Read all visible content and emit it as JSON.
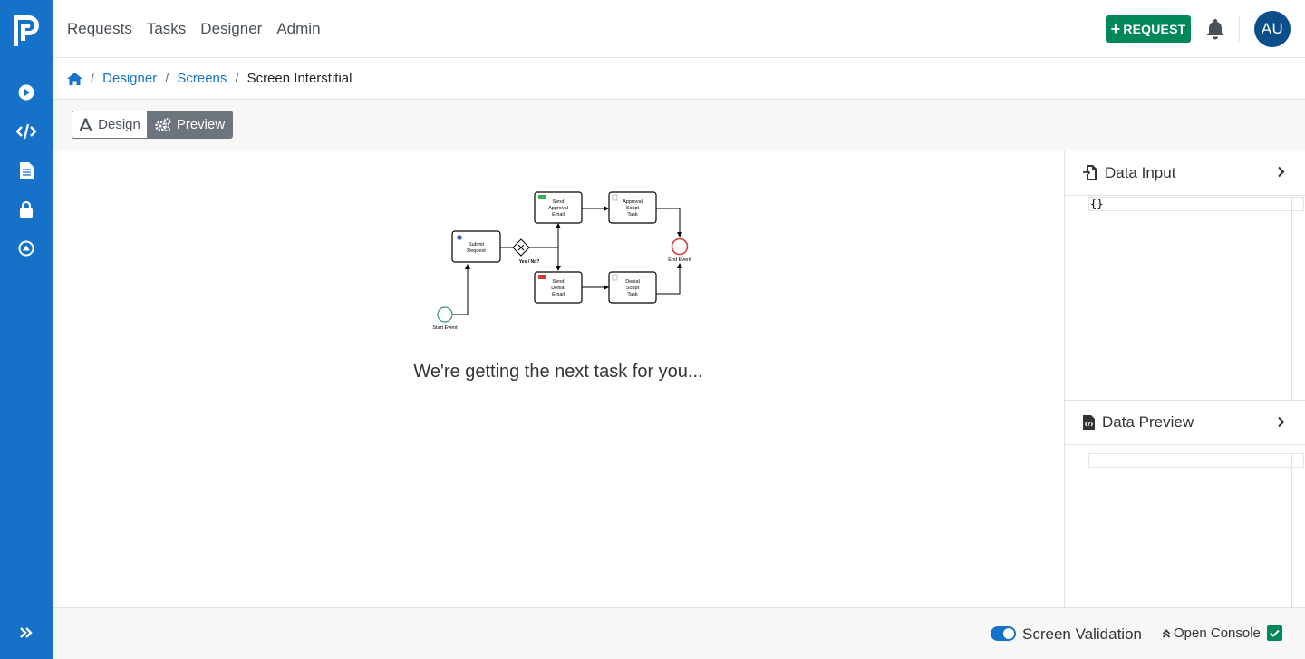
{
  "nav": {
    "links": [
      "Requests",
      "Tasks",
      "Designer",
      "Admin"
    ],
    "request_button": "REQUEST",
    "avatar_initials": "AU"
  },
  "sidebar": {
    "items": [
      "play-circle-icon",
      "code-icon",
      "file-icon",
      "lock-icon",
      "upload-circle-icon"
    ]
  },
  "breadcrumb": {
    "items": [
      "Designer",
      "Screens"
    ],
    "current": "Screen Interstitial"
  },
  "toolbar": {
    "design_label": "Design",
    "preview_label": "Preview"
  },
  "diagram": {
    "nodes": {
      "submit": [
        "Submit",
        "Request"
      ],
      "approval_email": [
        "Send",
        "Approval",
        "Email"
      ],
      "approval_script": [
        "Approval",
        "Script",
        "Task"
      ],
      "denial_email": [
        "Send",
        "Denial",
        "Email"
      ],
      "denial_script": [
        "Denial",
        "Script",
        "Task"
      ],
      "start_event": "Start Event",
      "end_event": "End Event",
      "gateway_label": "Yes / No?"
    }
  },
  "main": {
    "loading_message": "We're getting the next task for you..."
  },
  "right_panel": {
    "data_input_title": "Data Input",
    "data_input_value": "{}",
    "data_preview_title": "Data Preview"
  },
  "footer": {
    "screen_validation_label": "Screen Validation",
    "screen_validation_on": true,
    "open_console_label": "Open Console"
  },
  "colors": {
    "sidebar": "#1572c8",
    "request_button": "#00875a",
    "avatar": "#0a4e8a",
    "link": "#1572c8"
  }
}
